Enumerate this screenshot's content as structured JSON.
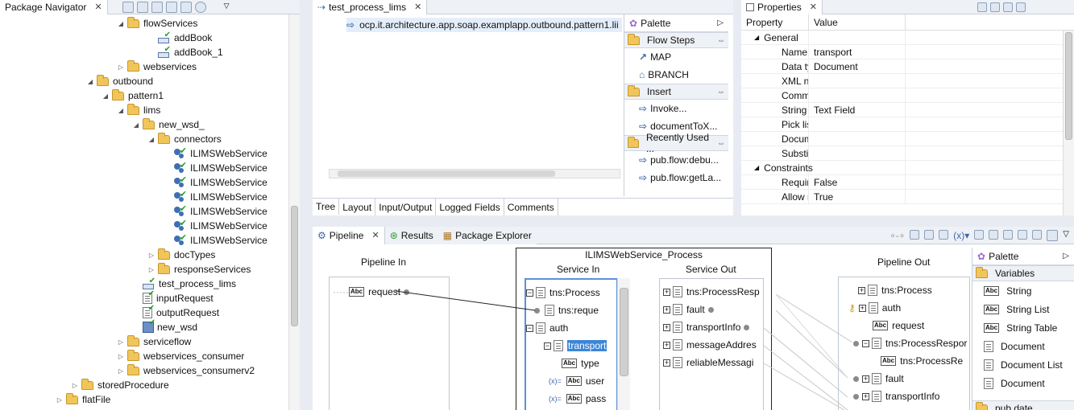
{
  "navigator": {
    "tab": "Package Navigator",
    "tree": [
      {
        "label": "flowServices",
        "icon": "folder-icon",
        "indent": 6,
        "tw": "◢"
      },
      {
        "label": "addBook",
        "icon": "flow-service-icon",
        "indent": 8,
        "tw": ""
      },
      {
        "label": "addBook_1",
        "icon": "flow-service-icon",
        "indent": 8,
        "tw": ""
      },
      {
        "label": "webservices",
        "icon": "folder-icon",
        "indent": 6,
        "tw": "▷"
      },
      {
        "label": "outbound",
        "icon": "folder-icon",
        "indent": 4,
        "tw": "◢"
      },
      {
        "label": "pattern1",
        "icon": "folder-icon",
        "indent": 5,
        "tw": "◢"
      },
      {
        "label": "lims",
        "icon": "folder-icon",
        "indent": 6,
        "tw": "◢"
      },
      {
        "label": "new_wsd_",
        "icon": "folder-icon",
        "indent": 7,
        "tw": "◢"
      },
      {
        "label": "connectors",
        "icon": "folder-icon",
        "indent": 8,
        "tw": "◢"
      },
      {
        "label": "ILIMSWebService",
        "icon": "connector-icon",
        "indent": 9,
        "tw": ""
      },
      {
        "label": "ILIMSWebService",
        "icon": "connector-icon",
        "indent": 9,
        "tw": ""
      },
      {
        "label": "ILIMSWebService",
        "icon": "connector-icon",
        "indent": 9,
        "tw": ""
      },
      {
        "label": "ILIMSWebService",
        "icon": "connector-icon",
        "indent": 9,
        "tw": ""
      },
      {
        "label": "ILIMSWebService",
        "icon": "connector-icon",
        "indent": 9,
        "tw": ""
      },
      {
        "label": "ILIMSWebService",
        "icon": "connector-icon",
        "indent": 9,
        "tw": ""
      },
      {
        "label": "ILIMSWebService",
        "icon": "connector-icon",
        "indent": 9,
        "tw": ""
      },
      {
        "label": "docTypes",
        "icon": "folder-icon",
        "indent": 8,
        "tw": "▷"
      },
      {
        "label": "responseServices",
        "icon": "folder-icon",
        "indent": 8,
        "tw": "▷"
      },
      {
        "label": "test_process_lims",
        "icon": "flow-service-icon",
        "indent": 7,
        "tw": ""
      },
      {
        "label": "inputRequest",
        "icon": "document-type-icon",
        "indent": 7,
        "tw": ""
      },
      {
        "label": "outputRequest",
        "icon": "document-type-icon",
        "indent": 7,
        "tw": ""
      },
      {
        "label": "new_wsd",
        "icon": "wsdl-icon",
        "indent": 7,
        "tw": ""
      },
      {
        "label": "serviceflow",
        "icon": "folder-icon",
        "indent": 6,
        "tw": "▷"
      },
      {
        "label": "webservices_consumer",
        "icon": "folder-icon",
        "indent": 6,
        "tw": "▷"
      },
      {
        "label": "webservices_consumerv2",
        "icon": "folder-icon",
        "indent": 6,
        "tw": "▷"
      },
      {
        "label": "storedProcedure",
        "icon": "folder-icon",
        "indent": 3,
        "tw": "▷"
      },
      {
        "label": "flatFile",
        "icon": "folder-icon",
        "indent": 2,
        "tw": "▷"
      }
    ]
  },
  "editor": {
    "tab": "test_process_lims",
    "step": "ocp.it.architecture.app.soap.examplapp.outbound.pattern1.lii",
    "bottom_tabs": [
      "Tree",
      "Layout",
      "Input/Output",
      "Logged Fields",
      "Comments"
    ],
    "palette": {
      "title": "Palette",
      "sections": [
        {
          "title": "Flow Steps",
          "items": [
            "MAP",
            "BRANCH"
          ]
        },
        {
          "title": "Insert",
          "items": [
            "Invoke...",
            "documentToX..."
          ]
        },
        {
          "title": "Recently Used ...",
          "items": [
            "pub.flow:debu...",
            "pub.flow:getLa..."
          ]
        }
      ]
    }
  },
  "properties": {
    "tab": "Properties",
    "col_property": "Property",
    "col_value": "Value",
    "rows": [
      {
        "name": "General",
        "value": "",
        "group": true
      },
      {
        "name": "Name",
        "value": "transport",
        "group": false
      },
      {
        "name": "Data typ",
        "value": "Document",
        "group": false
      },
      {
        "name": "XML na",
        "value": "",
        "group": false
      },
      {
        "name": "Comme",
        "value": "",
        "group": false
      },
      {
        "name": "String d",
        "value": "Text Field",
        "group": false
      },
      {
        "name": "Pick list",
        "value": "",
        "group": false
      },
      {
        "name": "Docum",
        "value": "",
        "group": false
      },
      {
        "name": "Substitu",
        "value": "",
        "group": false
      },
      {
        "name": "Constraints",
        "value": "",
        "group": true
      },
      {
        "name": "Require",
        "value": "False",
        "group": false
      },
      {
        "name": "Allow n",
        "value": "True",
        "group": false
      }
    ]
  },
  "pipeline": {
    "tabs": [
      "Pipeline",
      "Results",
      "Package Explorer"
    ],
    "service_name": "ILIMSWebService_Process",
    "pipeline_in": {
      "title": "Pipeline In",
      "items": [
        "request"
      ]
    },
    "service_in": {
      "title": "Service In",
      "items": [
        "tns:Process",
        "tns:reque",
        "auth",
        "transport",
        "type",
        "user",
        "pass"
      ]
    },
    "service_out": {
      "title": "Service Out",
      "items": [
        "tns:ProcessResp",
        "fault",
        "transportInfo",
        "messageAddres",
        "reliableMessagi"
      ]
    },
    "pipeline_out": {
      "title": "Pipeline Out",
      "items": [
        "tns:Process",
        "auth",
        "request",
        "tns:ProcessRespor",
        "tns:ProcessRe",
        "fault",
        "transportInfo"
      ]
    },
    "palette": {
      "title": "Palette",
      "section": "Variables",
      "items": [
        "String",
        "String List",
        "String Table",
        "Document",
        "Document List",
        "Document"
      ],
      "footer": "pub.date"
    }
  }
}
